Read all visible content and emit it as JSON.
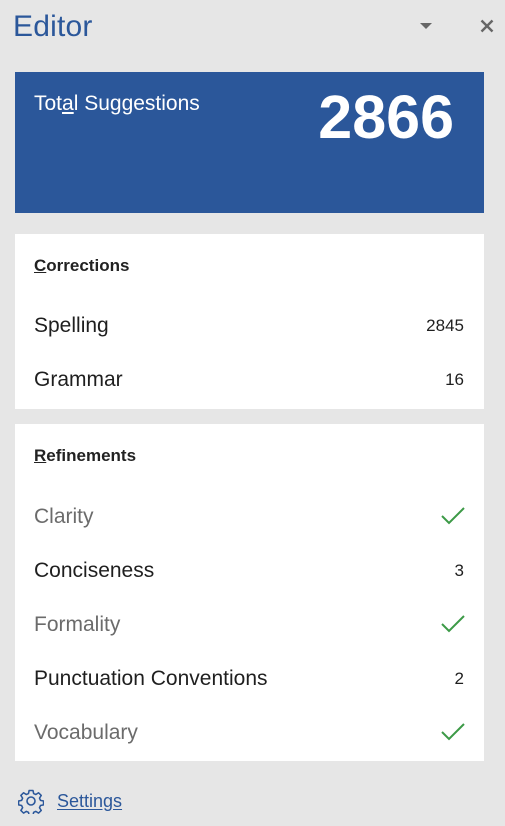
{
  "pane": {
    "title": "Editor",
    "dropdown_icon": "chevron-down-icon",
    "close_icon": "close-icon"
  },
  "total": {
    "label": "Total Suggestions",
    "value": "2866"
  },
  "corrections": {
    "heading": "Corrections",
    "items": [
      {
        "label": "Spelling",
        "count": "2845"
      },
      {
        "label": "Grammar",
        "count": "16"
      }
    ]
  },
  "refinements": {
    "heading": "Refinements",
    "items": [
      {
        "label": "Clarity",
        "status": "complete"
      },
      {
        "label": "Conciseness",
        "count": "3"
      },
      {
        "label": "Formality",
        "status": "complete"
      },
      {
        "label": "Punctuation Conventions",
        "count": "2"
      },
      {
        "label": "Vocabulary",
        "status": "complete"
      }
    ]
  },
  "settings": {
    "label": "Settings",
    "icon": "gear-icon"
  },
  "colors": {
    "accent": "#2b579a",
    "check": "#3c9a47",
    "background": "#e6e6e6"
  }
}
